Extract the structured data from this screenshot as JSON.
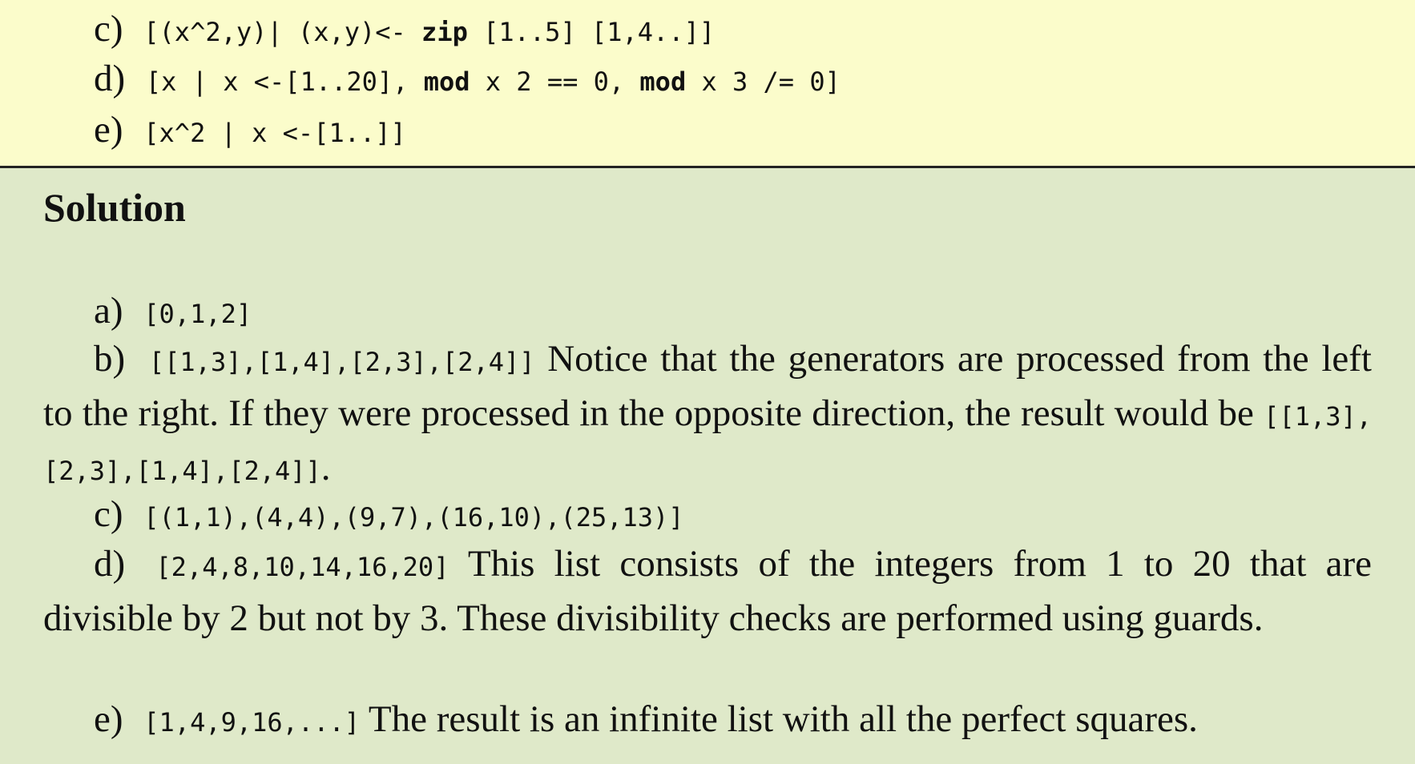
{
  "exercise": {
    "items": [
      {
        "label": "c)",
        "code": "[(x^2,y)| (x,y)<- zip [1..5] [1,4..]]"
      },
      {
        "label": "d)",
        "code": "[x | x <-[1..20], mod x 2 == 0, mod x 3 /= 0]"
      },
      {
        "label": "e)",
        "code": "[x^2 | x <-[1..]]"
      }
    ]
  },
  "solution": {
    "heading": "Solution",
    "a": {
      "label": "a)",
      "code": "[0,1,2]"
    },
    "b": {
      "label": "b)",
      "code": "[[1,3],[1,4],[2,3],[2,4]]",
      "text": "Notice that the generators are processed from the left to the right. If they were processed in the opposite direction, the result would be",
      "code2": "[[1,3],[2,3],[1,4],[2,4]]",
      "end": "."
    },
    "c": {
      "label": "c)",
      "code": "[(1,1),(4,4),(9,7),(16,10),(25,13)]"
    },
    "d": {
      "label": "d)",
      "code": "[2,4,8,10,14,16,20]",
      "text": "This list consists of the integers from 1 to 20 that are divisible by 2 but not by 3. These divisibility checks are performed using guards."
    },
    "e": {
      "label": "e)",
      "code": "[1,4,9,16,...]",
      "text": "The result is an infinite list with all the perfect squares."
    }
  }
}
